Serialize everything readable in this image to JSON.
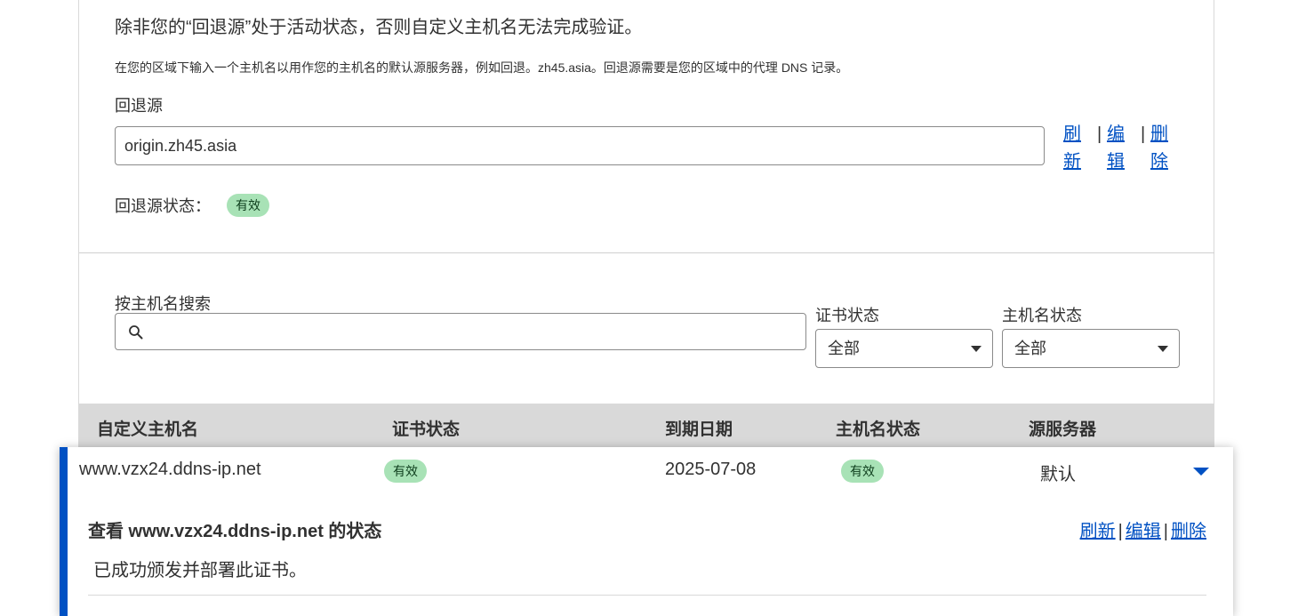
{
  "fallback": {
    "heading": "除非您的“回退源”处于活动状态，否则自定义主机名无法完成验证。",
    "description": "在您的区域下输入一个主机名以用作您的主机名的默认源服务器，例如回退。zh45.asia。回退源需要是您的区域中的代理 DNS 记录。",
    "label": "回退源",
    "value": "origin.zh45.asia",
    "actions": {
      "refresh": "刷新",
      "edit": "编辑",
      "delete": "删除",
      "separator": "|"
    },
    "status_label": "回退源状态：",
    "status_badge": "有效"
  },
  "filters": {
    "search_label": "按主机名搜索",
    "search_value": "",
    "cert_status_label": "证书状态",
    "cert_status_value": "全部",
    "hostname_status_label": "主机名状态",
    "hostname_status_value": "全部"
  },
  "table": {
    "headers": [
      "自定义主机名",
      "证书状态",
      "到期日期",
      "主机名状态",
      "源服务器"
    ],
    "rows": [
      {
        "hostname": "www.vzx24.ddns-ip.net",
        "cert_status": "有效",
        "expiry": "2025-07-08",
        "hostname_status": "有效",
        "origin": "默认",
        "detail_title": "查看 www.vzx24.ddns-ip.net 的状态",
        "detail_message": "已成功颁发并部署此证书。",
        "actions": {
          "refresh": "刷新",
          "edit": "编辑",
          "delete": "删除"
        }
      }
    ]
  },
  "icons": [
    "search-icon",
    "chevron-down-icon",
    "caret-down-icon"
  ],
  "colors": {
    "accent": "#0051c3",
    "badge_bg": "#a8e2b6",
    "header_bg": "#d9d9d9"
  }
}
